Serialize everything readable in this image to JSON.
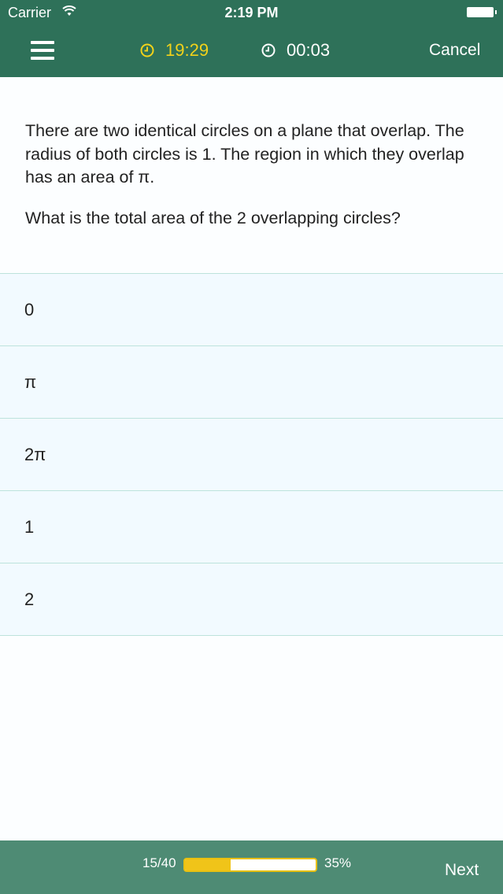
{
  "status_bar": {
    "carrier": "Carrier",
    "time": "2:19 PM"
  },
  "nav": {
    "menu_icon": "hamburger-menu-icon",
    "time_remaining": "19:29",
    "time_elapsed": "00:03",
    "cancel_label": "Cancel",
    "remaining_color": "#f2d21a"
  },
  "question": {
    "paragraph_1": "There are two identical circles on a plane that overlap. The radius of both circles is 1. The region in which they overlap has an area of π.",
    "paragraph_2": "What is the total area of the 2 overlapping circles?"
  },
  "answers": [
    {
      "label": "0"
    },
    {
      "label": "π"
    },
    {
      "label": "2π"
    },
    {
      "label": "1"
    },
    {
      "label": "2"
    }
  ],
  "footer": {
    "progress_count": "15/40",
    "progress_percent": "35%",
    "progress_fraction": 0.35,
    "next_label": "Next"
  },
  "colors": {
    "header": "#2e7159",
    "footer": "#4e8b74",
    "accent": "#f0c419"
  }
}
